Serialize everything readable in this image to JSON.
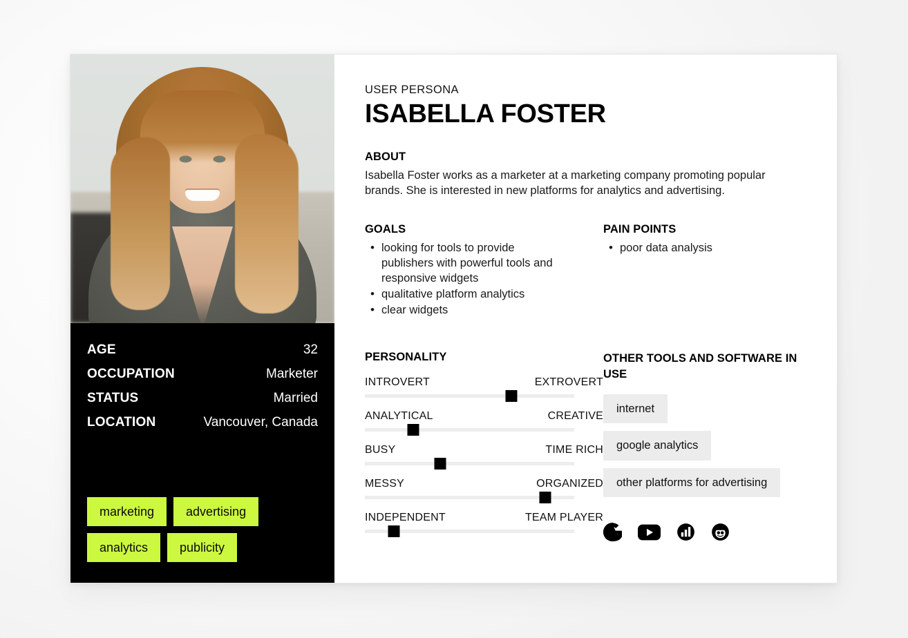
{
  "persona": {
    "eyebrow": "USER PERSONA",
    "name": "ISABELLA FOSTER"
  },
  "about": {
    "title": "ABOUT",
    "text": "Isabella Foster works as a marketer at a marketing company promoting popular brands. She is interested in new platforms for analytics and advertising."
  },
  "goals": {
    "title": "GOALS",
    "items": [
      "looking for tools to provide publishers with powerful tools and responsive widgets",
      "qualitative platform analytics",
      "clear widgets"
    ]
  },
  "pain_points": {
    "title": "PAIN POINTS",
    "items": [
      "poor data analysis"
    ]
  },
  "details": {
    "rows": [
      {
        "label": "AGE",
        "value": "32"
      },
      {
        "label": "OCCUPATION",
        "value": "Marketer"
      },
      {
        "label": "STATUS",
        "value": "Married"
      },
      {
        "label": "LOCATION",
        "value": "Vancouver, Canada"
      }
    ]
  },
  "tags": [
    "marketing",
    "advertising",
    "analytics",
    "publicity"
  ],
  "personality": {
    "title": "PERSONALITY",
    "sliders": [
      {
        "left": "INTROVERT",
        "right": "EXTROVERT",
        "value": 70
      },
      {
        "left": "ANALYTICAL",
        "right": "CREATIVE",
        "value": 23
      },
      {
        "left": "BUSY",
        "right": "TIME RICH",
        "value": 36
      },
      {
        "left": "MESSY",
        "right": "ORGANIZED",
        "value": 86
      },
      {
        "left": "INDEPENDENT",
        "right": "TEAM PLAYER",
        "value": 14
      }
    ]
  },
  "tools": {
    "title": "OTHER TOOLS AND SOFTWARE IN USE",
    "items": [
      "internet",
      "google analytics",
      "other platforms for advertising"
    ],
    "icons": [
      "google-icon",
      "youtube-icon",
      "google-analytics-icon",
      "reddit-icon"
    ]
  },
  "colors": {
    "accent_green": "#ccf83f",
    "panel_black": "#000000",
    "chip_gray": "#ececec",
    "track_gray": "#ededed"
  }
}
